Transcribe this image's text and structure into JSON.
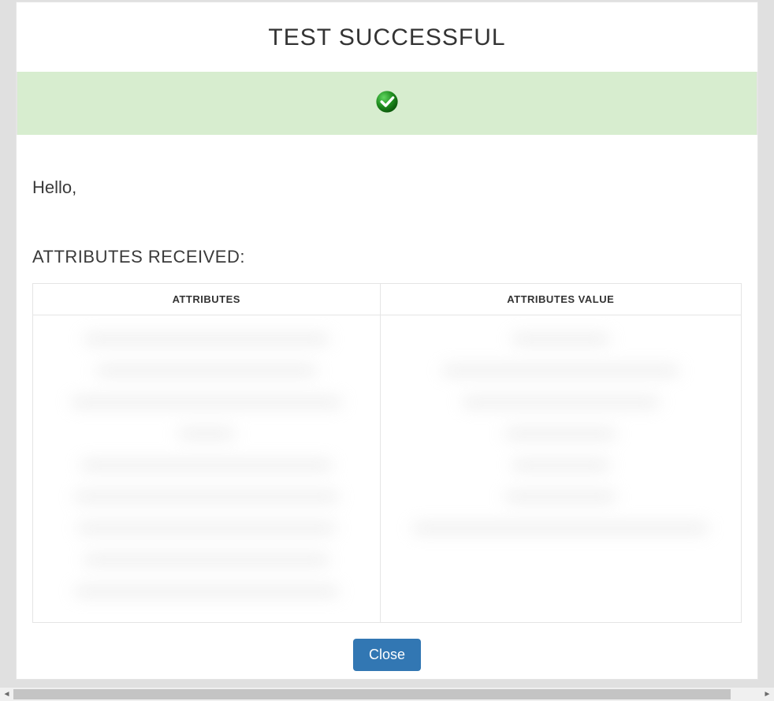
{
  "dialog": {
    "title": "TEST SUCCESSFUL",
    "greeting": "Hello,",
    "section_heading": "ATTRIBUTES RECEIVED:",
    "table": {
      "headers": {
        "attributes": "ATTRIBUTES",
        "attributes_value": "ATTRIBUTES VALUE"
      }
    },
    "close_label": "Close"
  },
  "colors": {
    "success_bar_bg": "#d7edcf",
    "check_fill": "#1f8c1f",
    "primary_button": "#3277b3"
  }
}
